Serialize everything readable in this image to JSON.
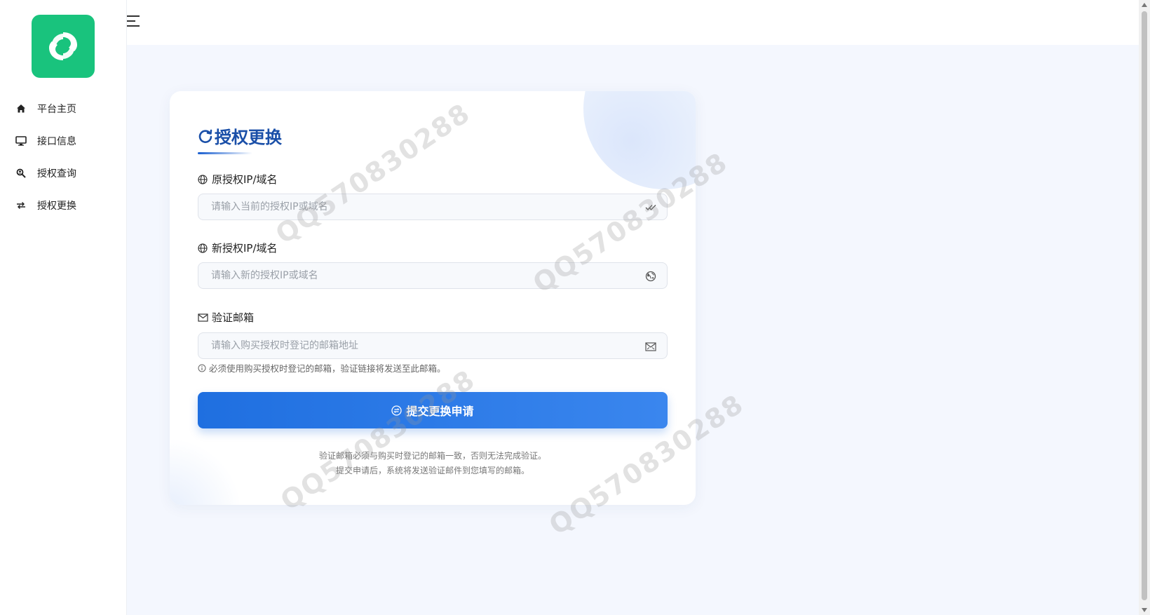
{
  "sidebar": {
    "logo_alt": "logo",
    "items": [
      {
        "label": "平台主页",
        "icon": "home-icon"
      },
      {
        "label": "接口信息",
        "icon": "monitor-icon"
      },
      {
        "label": "授权查询",
        "icon": "search-person-icon"
      },
      {
        "label": "授权更换",
        "icon": "swap-icon"
      }
    ]
  },
  "header": {
    "menu_icon": "hamburger-icon"
  },
  "form": {
    "title": "授权更换",
    "title_icon": "refresh-icon",
    "old_ip": {
      "label": "原授权IP/域名",
      "placeholder": "请输入当前的授权IP或域名",
      "label_icon": "globe-icon",
      "input_icon": "double-check-icon"
    },
    "new_ip": {
      "label": "新授权IP/域名",
      "placeholder": "请输入新的授权IP或域名",
      "label_icon": "globe-icon",
      "input_icon": "earth-icon"
    },
    "email": {
      "label": "验证邮箱",
      "placeholder": "请输入购买授权时登记的邮箱地址",
      "label_icon": "mail-icon",
      "input_icon": "mail-send-icon"
    },
    "hint": "必须使用购买授权时登记的邮箱，验证链接将发送至此邮箱。",
    "hint_icon": "info-icon",
    "submit_label": "提交更换申请",
    "submit_icon": "exchange-circle-icon",
    "footnote_line1": "验证邮箱必须与购买时登记的邮箱一致，否则无法完成验证。",
    "footnote_line2": "提交申请后，系统将发送验证邮件到您填写的邮箱。"
  },
  "watermark": "QQ570830288",
  "colors": {
    "brand_green": "#19c37d",
    "primary_blue": "#1f6fe0",
    "title_blue": "#1a4fa8",
    "background": "#f4f7fe"
  }
}
